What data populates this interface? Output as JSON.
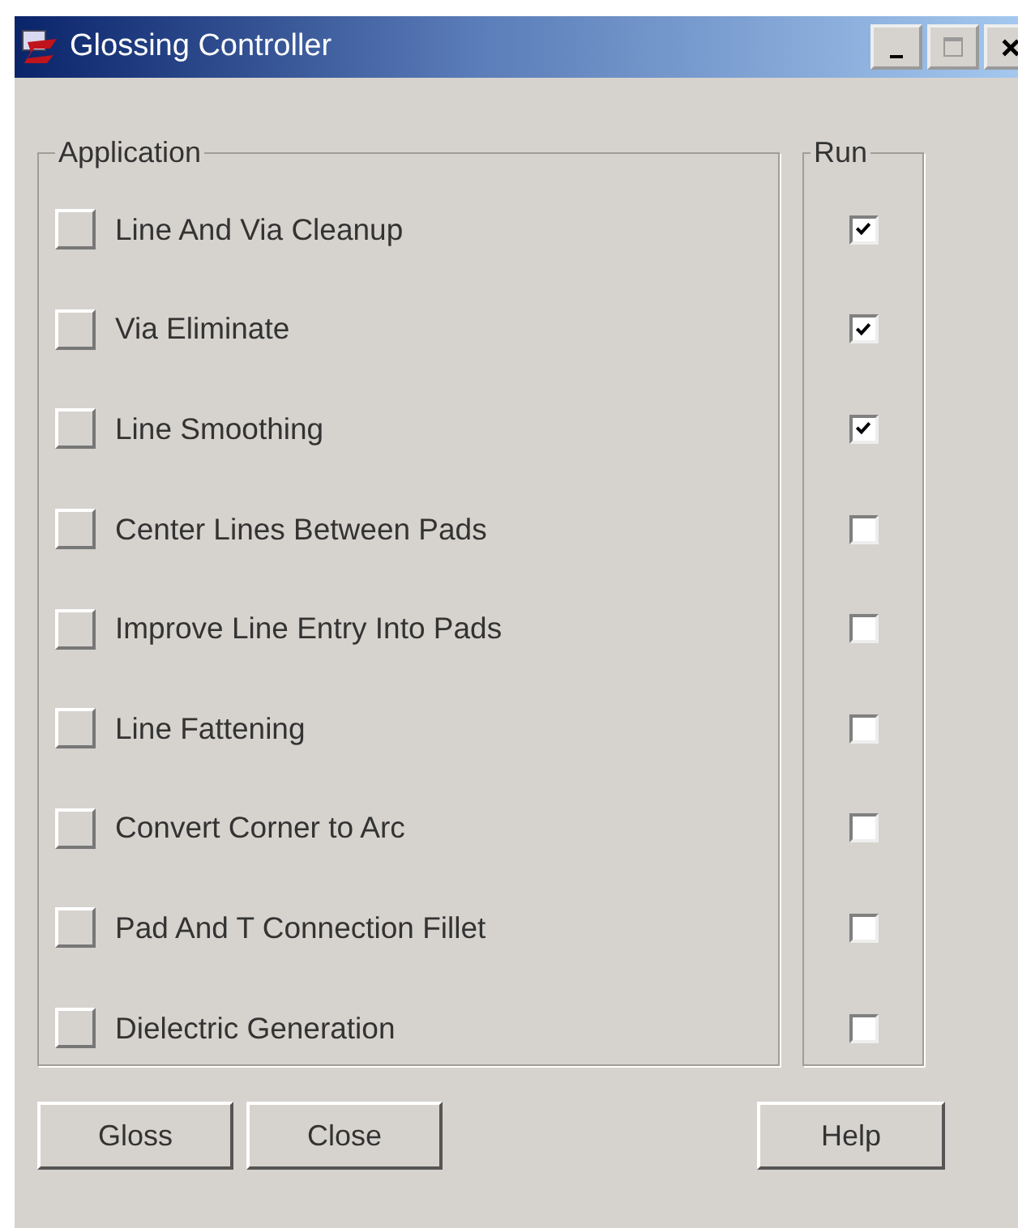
{
  "window": {
    "title": "Glossing Controller"
  },
  "application_group": {
    "label": "Application"
  },
  "run_group": {
    "label": "Run"
  },
  "items": [
    {
      "label": "Line And Via Cleanup",
      "checked": true
    },
    {
      "label": "Via Eliminate",
      "checked": true
    },
    {
      "label": "Line Smoothing",
      "checked": true
    },
    {
      "label": "Center Lines Between Pads",
      "checked": false
    },
    {
      "label": "Improve Line Entry Into Pads",
      "checked": false
    },
    {
      "label": "Line Fattening",
      "checked": false
    },
    {
      "label": "Convert Corner to Arc",
      "checked": false
    },
    {
      "label": "Pad And T Connection Fillet",
      "checked": false
    },
    {
      "label": "Dielectric Generation",
      "checked": false
    }
  ],
  "buttons": [
    {
      "label": "Gloss",
      "kind": "left"
    },
    {
      "label": "Close",
      "kind": "left"
    },
    {
      "label": "Help",
      "kind": "right"
    }
  ]
}
